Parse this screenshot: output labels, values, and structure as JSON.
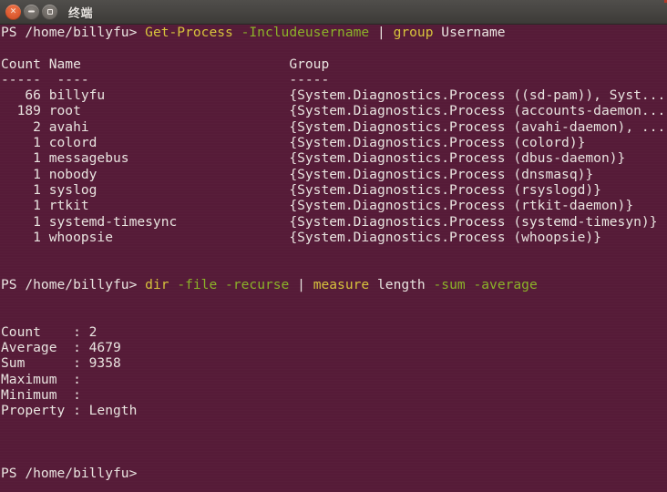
{
  "window": {
    "title": "终端",
    "controls": [
      {
        "name": "close",
        "glyph": "×"
      },
      {
        "name": "minimize",
        "glyph": ""
      },
      {
        "name": "maximize",
        "glyph": ""
      }
    ],
    "colors": {
      "titlebar_top": "#504e4b",
      "titlebar_bottom": "#3c3a37",
      "terminal_background": "#561b38",
      "foreground": "#e9e4e0",
      "command_yellow": "#d7c33c",
      "parameter_green": "#8bb229",
      "close_button": "#dd5b31"
    }
  },
  "terminal": {
    "prompt": "PS /home/billyfu>",
    "blocks": [
      {
        "name": "get-process-command",
        "command_parts": [
          {
            "text": "PS /home/billyfu> ",
            "color": "white"
          },
          {
            "text": "Get-Process",
            "color": "yellow"
          },
          {
            "text": " ",
            "color": "white"
          },
          {
            "text": "-Includeusername",
            "color": "green"
          },
          {
            "text": " | ",
            "color": "white"
          },
          {
            "text": "group",
            "color": "yellow"
          },
          {
            "text": " Username",
            "color": "white"
          }
        ]
      },
      {
        "name": "measure-command",
        "command_parts": [
          {
            "text": "PS /home/billyfu> ",
            "color": "white"
          },
          {
            "text": "dir",
            "color": "yellow"
          },
          {
            "text": " ",
            "color": "white"
          },
          {
            "text": "-file",
            "color": "green"
          },
          {
            "text": " ",
            "color": "white"
          },
          {
            "text": "-recurse",
            "color": "green"
          },
          {
            "text": " | ",
            "color": "white"
          },
          {
            "text": "measure",
            "color": "yellow"
          },
          {
            "text": " length ",
            "color": "white"
          },
          {
            "text": "-sum",
            "color": "green"
          },
          {
            "text": " ",
            "color": "white"
          },
          {
            "text": "-average",
            "color": "green"
          }
        ]
      }
    ],
    "group_table": {
      "headers": {
        "count": "Count",
        "name": "Name",
        "group": "Group"
      },
      "separators": {
        "count": "-----",
        "name": "----",
        "group": "-----"
      },
      "rows": [
        {
          "count": "66",
          "name": "billyfu",
          "group": "{System.Diagnostics.Process ((sd-pam)), Syst..."
        },
        {
          "count": "189",
          "name": "root",
          "group": "{System.Diagnostics.Process (accounts-daemon..."
        },
        {
          "count": "2",
          "name": "avahi",
          "group": "{System.Diagnostics.Process (avahi-daemon), ..."
        },
        {
          "count": "1",
          "name": "colord",
          "group": "{System.Diagnostics.Process (colord)}"
        },
        {
          "count": "1",
          "name": "messagebus",
          "group": "{System.Diagnostics.Process (dbus-daemon)}"
        },
        {
          "count": "1",
          "name": "nobody",
          "group": "{System.Diagnostics.Process (dnsmasq)}"
        },
        {
          "count": "1",
          "name": "syslog",
          "group": "{System.Diagnostics.Process (rsyslogd)}"
        },
        {
          "count": "1",
          "name": "rtkit",
          "group": "{System.Diagnostics.Process (rtkit-daemon)}"
        },
        {
          "count": "1",
          "name": "systemd-timesync",
          "group": "{System.Diagnostics.Process (systemd-timesyn)}"
        },
        {
          "count": "1",
          "name": "whoopsie",
          "group": "{System.Diagnostics.Process (whoopsie)}"
        }
      ]
    },
    "measure_output": [
      {
        "label": "Count",
        "value": "2"
      },
      {
        "label": "Average",
        "value": "4679"
      },
      {
        "label": "Sum",
        "value": "9358"
      },
      {
        "label": "Maximum",
        "value": ""
      },
      {
        "label": "Minimum",
        "value": ""
      },
      {
        "label": "Property",
        "value": "Length"
      }
    ],
    "final_prompt": "PS /home/billyfu>"
  }
}
